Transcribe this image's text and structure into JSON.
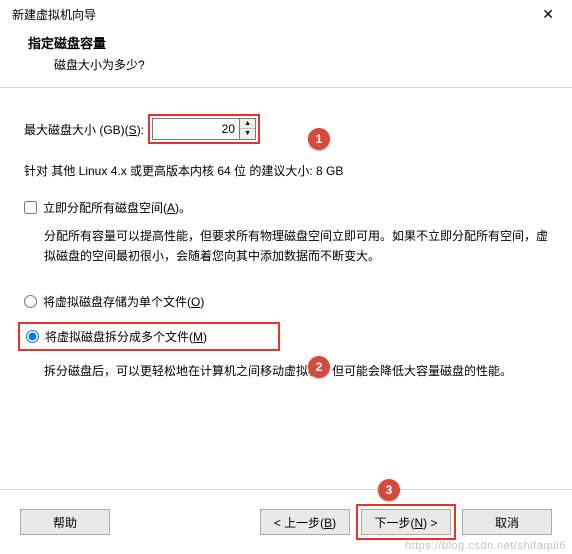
{
  "window": {
    "title": "新建虚拟机向导",
    "close": "✕"
  },
  "header": {
    "title": "指定磁盘容量",
    "subtitle": "磁盘大小为多少?"
  },
  "disk": {
    "label_pre": "最大磁盘大小 (GB)(",
    "label_ul": "S",
    "label_post": "):",
    "value": "20",
    "spin_up": "▲",
    "spin_down": "▼"
  },
  "hint": "针对 其他 Linux 4.x 或更高版本内核 64 位 的建议大小: 8 GB",
  "allocate": {
    "label_pre": "立即分配所有磁盘空间(",
    "label_ul": "A",
    "label_post": ")。",
    "desc": "分配所有容量可以提高性能，但要求所有物理磁盘空间立即可用。如果不立即分配所有空间，虚拟磁盘的空间最初很小，会随着您向其中添加数据而不断变大。"
  },
  "radio_single": {
    "label_pre": "将虚拟磁盘存储为单个文件(",
    "label_ul": "O",
    "label_post": ")"
  },
  "radio_split": {
    "label_pre": "将虚拟磁盘拆分成多个文件(",
    "label_ul": "M",
    "label_post": ")",
    "desc": "拆分磁盘后，可以更轻松地在计算机之间移动虚拟机，但可能会降低大容量磁盘的性能。"
  },
  "buttons": {
    "help": "帮助",
    "back_pre": "< 上一步(",
    "back_ul": "B",
    "back_post": ")",
    "next_pre": "下一步(",
    "next_ul": "N",
    "next_post": ") >",
    "cancel": "取消"
  },
  "callouts": {
    "c1": "1",
    "c2": "2",
    "c3": "3"
  },
  "watermark": "https://blog.csdn.net/shifaqui6"
}
